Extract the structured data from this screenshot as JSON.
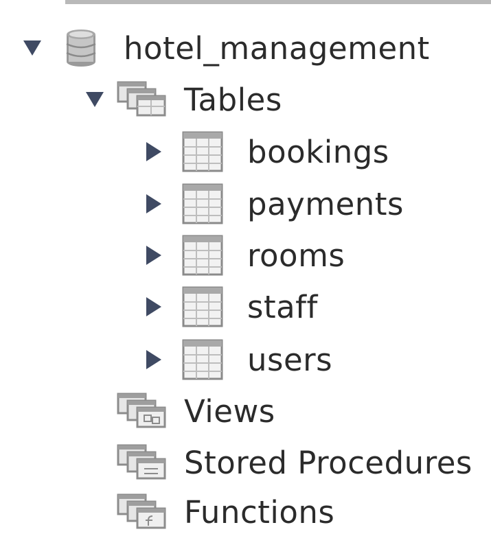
{
  "tree": {
    "schema": {
      "name": "hotel_management",
      "expanded": true,
      "icon": "database-icon"
    },
    "tables_folder": {
      "label": "Tables",
      "expanded": true,
      "icon": "folder-tables-icon"
    },
    "tables": [
      {
        "name": "bookings",
        "expanded": false,
        "icon": "table-icon"
      },
      {
        "name": "payments",
        "expanded": false,
        "icon": "table-icon"
      },
      {
        "name": "rooms",
        "expanded": false,
        "icon": "table-icon"
      },
      {
        "name": "staff",
        "expanded": false,
        "icon": "table-icon"
      },
      {
        "name": "users",
        "expanded": false,
        "icon": "table-icon"
      }
    ],
    "views_folder": {
      "label": "Views",
      "icon": "folder-views-icon"
    },
    "procedures_folder": {
      "label": "Stored Procedures",
      "icon": "folder-procedures-icon"
    },
    "functions_folder": {
      "label": "Functions",
      "icon": "folder-functions-icon"
    }
  },
  "colors": {
    "twisty": "#3f4a63",
    "text": "#2b2b2b",
    "icon_gray": "#9a9a9a"
  }
}
